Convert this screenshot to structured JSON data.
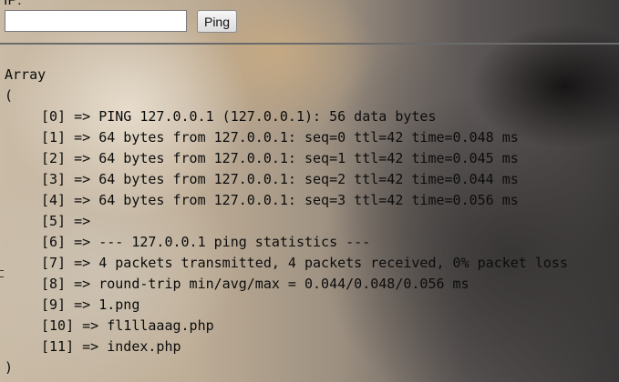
{
  "form": {
    "label": "IP:",
    "input_value": "",
    "button_label": "Ping"
  },
  "output": {
    "open_line": "Array",
    "open_paren": "(",
    "entries": [
      "[0] => PING 127.0.0.1 (127.0.0.1): 56 data bytes",
      "[1] => 64 bytes from 127.0.0.1: seq=0 ttl=42 time=0.048 ms",
      "[2] => 64 bytes from 127.0.0.1: seq=1 ttl=42 time=0.045 ms",
      "[3] => 64 bytes from 127.0.0.1: seq=2 ttl=42 time=0.044 ms",
      "[4] => 64 bytes from 127.0.0.1: seq=3 ttl=42 time=0.056 ms",
      "[5] =>",
      "[6] => --- 127.0.0.1 ping statistics ---",
      "[7] => 4 packets transmitted, 4 packets received, 0% packet loss",
      "[8] => round-trip min/avg/max = 0.044/0.048/0.056 ms",
      "[9] => 1.png",
      "[10] => fl1llaaag.php",
      "[11] => index.php"
    ],
    "close_paren": ")"
  }
}
